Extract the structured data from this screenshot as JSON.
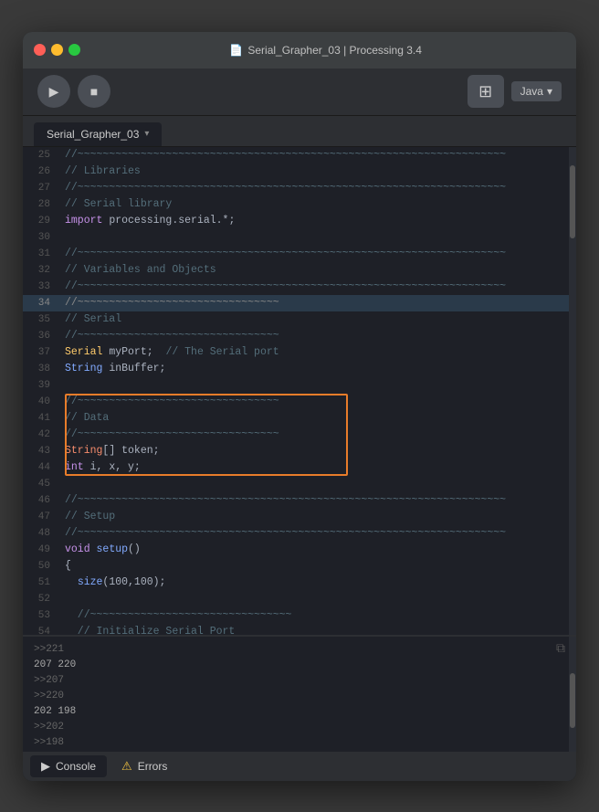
{
  "titlebar": {
    "title": "Serial_Grapher_03 | Processing 3.4",
    "file_icon": "📄"
  },
  "toolbar": {
    "run_icon": "▶",
    "stop_icon": "■",
    "mode_icon": "⊞",
    "java_label": "Java",
    "dropdown_icon": "▾"
  },
  "tabs": [
    {
      "label": "Serial_Grapher_03",
      "active": true
    }
  ],
  "code": {
    "lines": [
      {
        "num": "25",
        "content": "//~~~~~~~~~~~~~~~~~~~~~~~~~~~~~~~~~~~~~~~~~~~~~~~~~~~~~~~~~~~~~~~~~~~~",
        "highlight": false
      },
      {
        "num": "26",
        "content": "// Libraries",
        "highlight": false
      },
      {
        "num": "27",
        "content": "//~~~~~~~~~~~~~~~~~~~~~~~~~~~~~~~~~~~~~~~~~~~~~~~~~~~~~~~~~~~~~~~~~~~~",
        "highlight": false
      },
      {
        "num": "28",
        "content": "// Serial library",
        "highlight": false
      },
      {
        "num": "29",
        "content": "import processing.serial.*;",
        "highlight": false,
        "tokens": [
          {
            "t": "import",
            "c": "import-kw"
          },
          {
            "t": " processing.serial.*;",
            "c": "normal"
          }
        ]
      },
      {
        "num": "30",
        "content": "",
        "highlight": false
      },
      {
        "num": "31",
        "content": "//~~~~~~~~~~~~~~~~~~~~~~~~~~~~~~~~~~~~~~~~~~~~~~~~~~~~~~~~~~~~~~~~~~~~",
        "highlight": false
      },
      {
        "num": "32",
        "content": "// Variables and Objects",
        "highlight": false
      },
      {
        "num": "33",
        "content": "//~~~~~~~~~~~~~~~~~~~~~~~~~~~~~~~~~~~~~~~~~~~~~~~~~~~~~~~~~~~~~~~~~~~~",
        "highlight": false
      },
      {
        "num": "34",
        "content": "//~~~~~~~~~~~~~~~~~~~~~~~~~~~~~~~~",
        "highlight": true
      },
      {
        "num": "35",
        "content": "// Serial",
        "highlight": false
      },
      {
        "num": "36",
        "content": "//~~~~~~~~~~~~~~~~~~~~~~~~~~~~~~~~",
        "highlight": false
      },
      {
        "num": "37",
        "content": "Serial myPort;  // The Serial port",
        "highlight": false,
        "tokens": [
          {
            "t": "Serial",
            "c": "type"
          },
          {
            "t": " myPort;  ",
            "c": "normal"
          },
          {
            "t": "// The Serial port",
            "c": "comment"
          }
        ]
      },
      {
        "num": "38",
        "content": "String inBuffer;",
        "highlight": false,
        "tokens": [
          {
            "t": "String",
            "c": "kw-blue"
          },
          {
            "t": " inBuffer;",
            "c": "normal"
          }
        ]
      },
      {
        "num": "39",
        "content": "",
        "highlight": false
      },
      {
        "num": "40",
        "content": "//~~~~~~~~~~~~~~~~~~~~~~~~~~~~~~~~",
        "highlight": false,
        "selected_start": true
      },
      {
        "num": "41",
        "content": "// Data",
        "highlight": false,
        "selected": true
      },
      {
        "num": "42",
        "content": "//~~~~~~~~~~~~~~~~~~~~~~~~~~~~~~~~",
        "highlight": false,
        "selected": true
      },
      {
        "num": "43",
        "content": "String[] token;",
        "highlight": false,
        "selected": true,
        "tokens": [
          {
            "t": "String",
            "c": "string-type"
          },
          {
            "t": "[] token;",
            "c": "normal"
          }
        ]
      },
      {
        "num": "44",
        "content": "int i, x, y;",
        "highlight": false,
        "selected_end": true,
        "tokens": [
          {
            "t": "int",
            "c": "int-type"
          },
          {
            "t": " i, x, y;",
            "c": "normal"
          }
        ]
      },
      {
        "num": "45",
        "content": "",
        "highlight": false
      },
      {
        "num": "46",
        "content": "//~~~~~~~~~~~~~~~~~~~~~~~~~~~~~~~~~~~~~~~~~~~~~~~~~~~~~~~~~~~~~~~~~~~~",
        "highlight": false
      },
      {
        "num": "47",
        "content": "// Setup",
        "highlight": false
      },
      {
        "num": "48",
        "content": "//~~~~~~~~~~~~~~~~~~~~~~~~~~~~~~~~~~~~~~~~~~~~~~~~~~~~~~~~~~~~~~~~~~~~",
        "highlight": false
      },
      {
        "num": "49",
        "content": "void setup()",
        "highlight": false,
        "tokens": [
          {
            "t": "void",
            "c": "kw-void"
          },
          {
            "t": " ",
            "c": "normal"
          },
          {
            "t": "setup",
            "c": "fn-call"
          },
          {
            "t": "()",
            "c": "normal"
          }
        ]
      },
      {
        "num": "50",
        "content": "{",
        "highlight": false
      },
      {
        "num": "51",
        "content": "  size(100,100);",
        "highlight": false,
        "tokens": [
          {
            "t": "  ",
            "c": "normal"
          },
          {
            "t": "size",
            "c": "fn-call"
          },
          {
            "t": "(100,100);",
            "c": "normal"
          }
        ]
      },
      {
        "num": "52",
        "content": "",
        "highlight": false
      },
      {
        "num": "53",
        "content": "  //~~~~~~~~~~~~~~~~~~~~~~~~~~~~~~~~",
        "highlight": false
      },
      {
        "num": "54",
        "content": "  // Initialize Serial Port",
        "highlight": false
      }
    ]
  },
  "console": {
    "lines": [
      {
        "content": ">>221"
      },
      {
        "content": "207    220"
      },
      {
        "content": ">>207"
      },
      {
        "content": ">>220"
      },
      {
        "content": "202    198"
      },
      {
        "content": ">>202"
      },
      {
        "content": ">>198"
      }
    ]
  },
  "bottom_tabs": [
    {
      "label": "Console",
      "icon": "▶",
      "active": true
    },
    {
      "label": "Errors",
      "icon": "⚠",
      "active": false
    }
  ]
}
